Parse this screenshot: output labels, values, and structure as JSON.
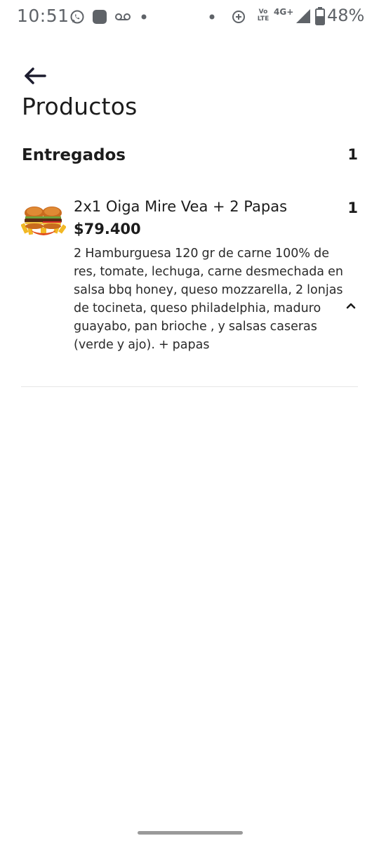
{
  "status_bar": {
    "time": "10:51",
    "network_type": "4G+",
    "volte_label_top": "Vo",
    "volte_label_bottom": "LTE",
    "battery": "48%",
    "icons": [
      "whatsapp-icon",
      "app-icon",
      "voicemail-icon",
      "dot-icon",
      "dot-icon",
      "data-saver-icon",
      "volte-icon",
      "signal-icon",
      "battery-icon"
    ]
  },
  "header": {
    "back_icon": "arrow-left-icon",
    "title": "Productos"
  },
  "section": {
    "title": "Entregados",
    "count": "1"
  },
  "products": [
    {
      "image_icon": "burger-image",
      "name": "2x1 Oiga Mire Vea + 2 Papas",
      "quantity": "1",
      "price": "$79.400",
      "description": "2 Hamburguesa 120 gr de carne 100% de res, tomate, lechuga, carne desmechada en salsa bbq honey, queso mozzarella, 2 lonjas de tocineta, queso philadelphia, maduro guayabo, pan brioche , y salsas caseras (verde y ajo). + papas",
      "toggle_icon": "chevron-up-icon"
    }
  ],
  "colors": {
    "text": "#1c1c1c",
    "status_icons": "#5f6368",
    "divider": "#e6e6e6",
    "home_indicator": "#9a9a9a"
  }
}
